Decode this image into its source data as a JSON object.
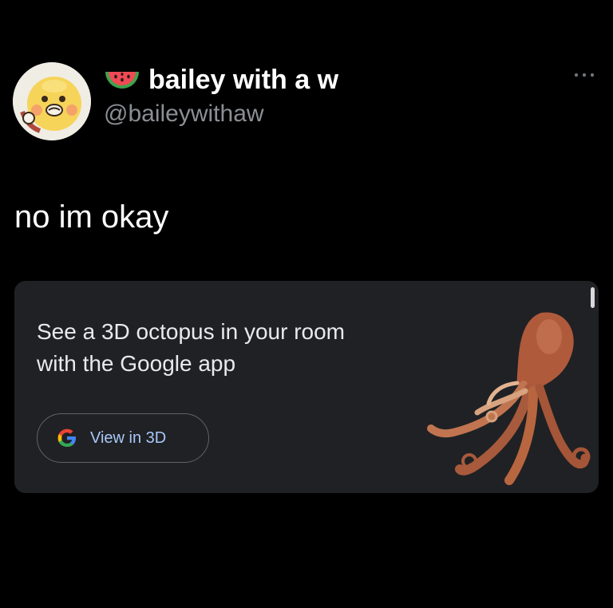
{
  "tweet": {
    "display_name": "bailey with a w",
    "handle": "@baileywithaw",
    "body_text": "no im okay",
    "name_emoji": "watermelon-icon",
    "avatar_icon": "cartoon-duck-avatar",
    "menu_icon": "more-options-icon"
  },
  "promo_card": {
    "headline": "See a 3D octopus in your room with the Google app",
    "button_label": "View in 3D",
    "button_icon": "google-g-icon",
    "image": "octopus-3d-icon"
  },
  "colors": {
    "background": "#000000",
    "card_background": "#202124",
    "handle_text": "#8b8f94",
    "button_text": "#a8c7fa"
  }
}
